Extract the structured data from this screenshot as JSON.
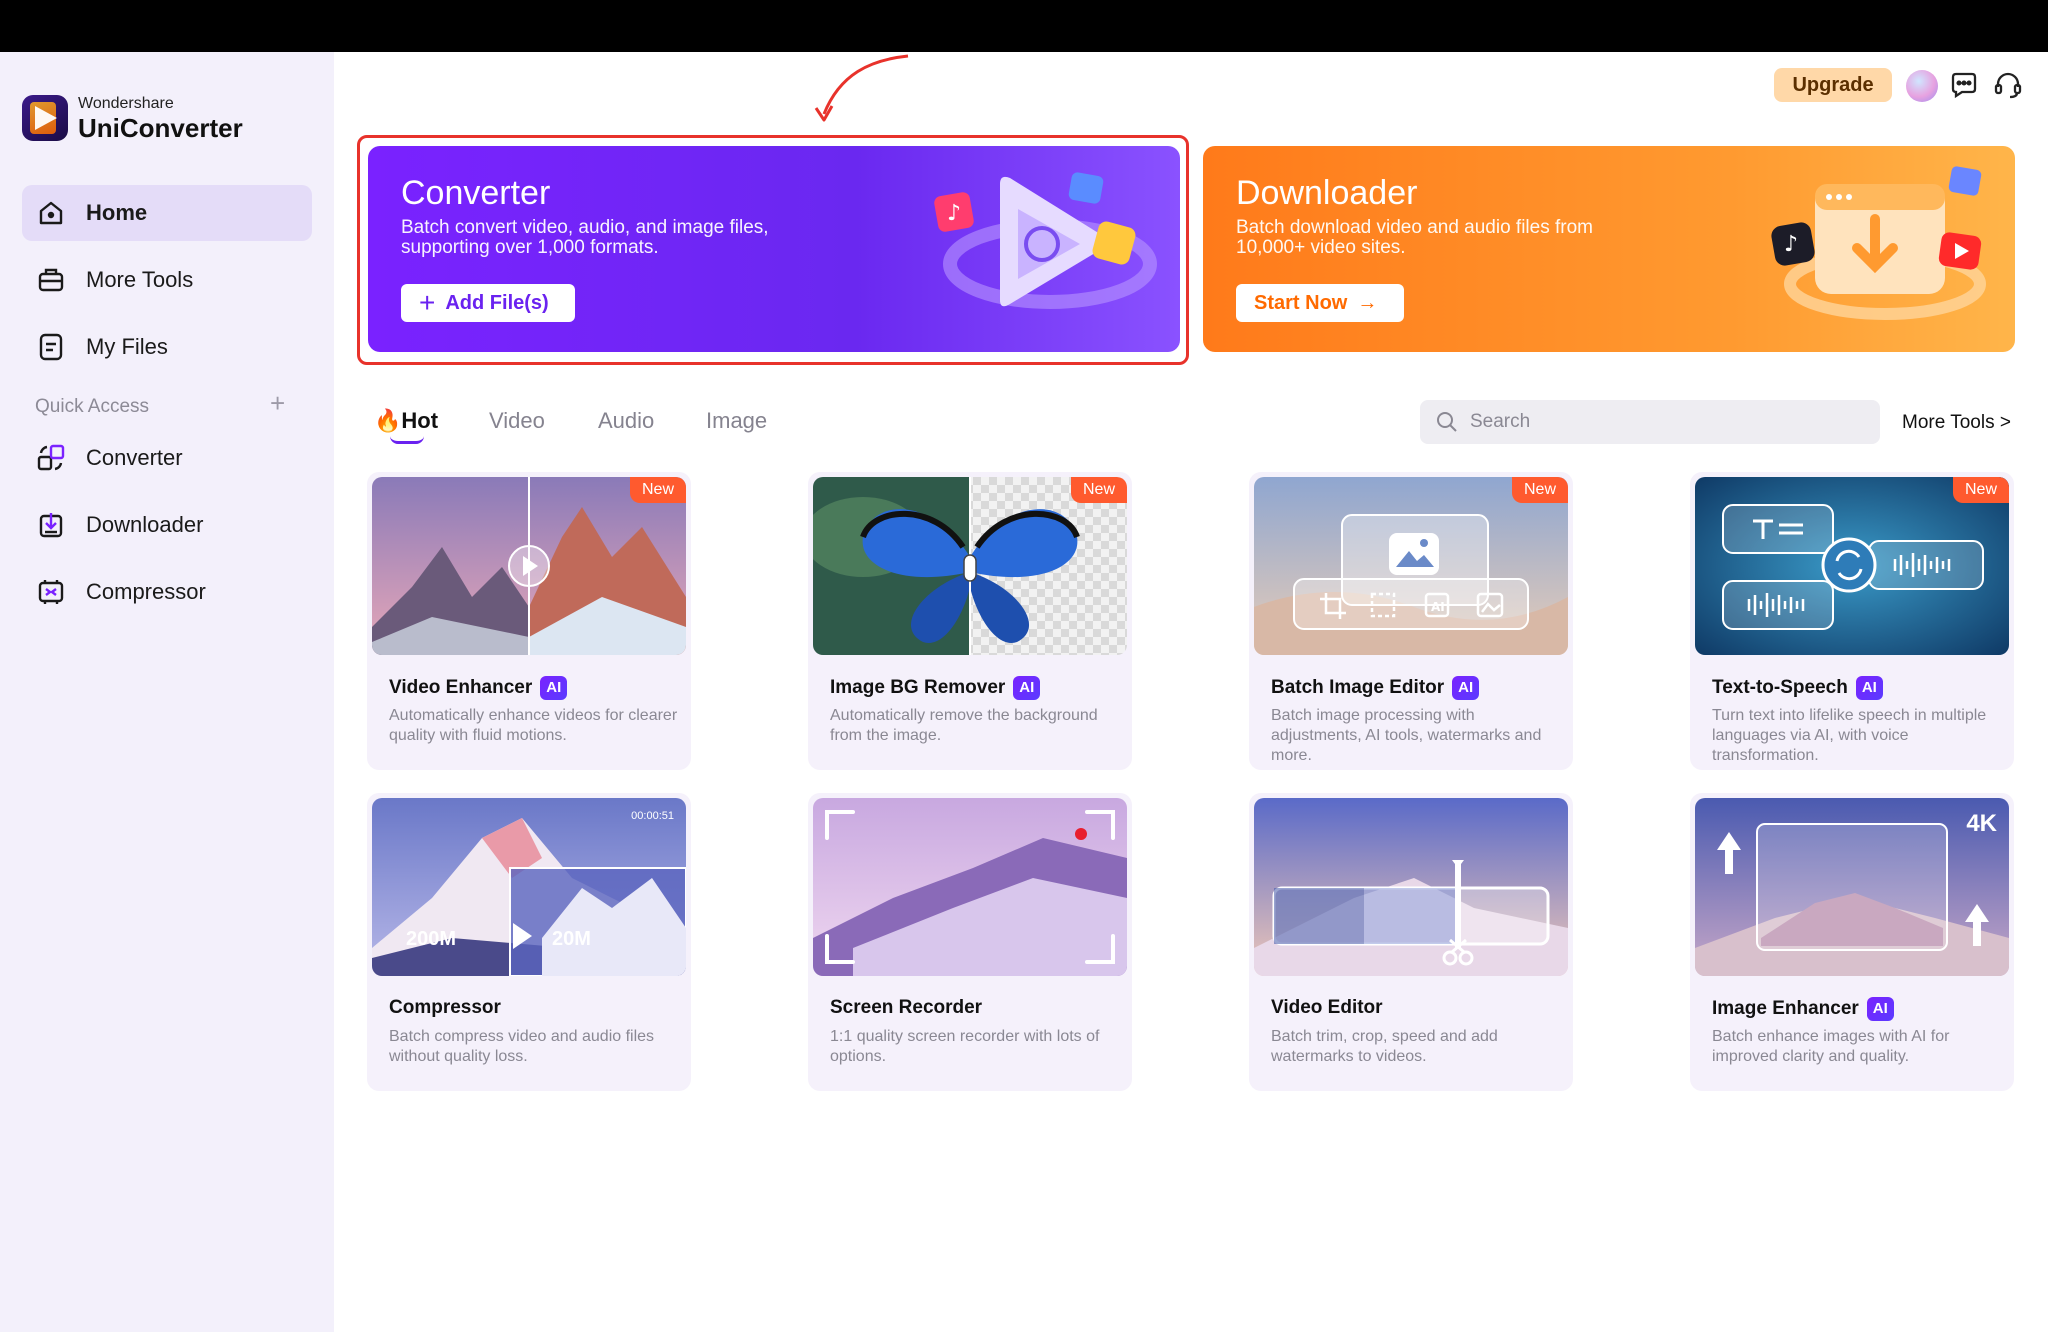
{
  "app": {
    "brand": "Wondershare",
    "name": "UniConverter"
  },
  "sidebar": {
    "items": [
      {
        "label": "Home",
        "icon": "home-icon",
        "active": true
      },
      {
        "label": "More Tools",
        "icon": "toolbox-icon"
      },
      {
        "label": "My Files",
        "icon": "file-icon"
      }
    ],
    "quick_access_title": "Quick Access",
    "quick_access_add": "+",
    "quick_access": [
      {
        "label": "Converter",
        "icon": "converter-icon"
      },
      {
        "label": "Downloader",
        "icon": "downloader-icon"
      },
      {
        "label": "Compressor",
        "icon": "compressor-icon"
      }
    ]
  },
  "header": {
    "upgrade_label": "Upgrade"
  },
  "banners": {
    "converter": {
      "title": "Converter",
      "description": "Batch convert video, audio, and image files, supporting over 1,000 formats.",
      "button": "Add File(s)",
      "button_icon": "+"
    },
    "downloader": {
      "title": "Downloader",
      "description": "Batch download video and audio files from 10,000+ video sites.",
      "button": "Start Now",
      "button_icon": "→"
    }
  },
  "tabs": [
    "Hot",
    "Video",
    "Audio",
    "Image"
  ],
  "search": {
    "placeholder": "Search"
  },
  "more_tools_link": "More Tools >",
  "new_badge": "New",
  "ai_badge": "AI",
  "cards": [
    {
      "title": "Video Enhancer",
      "ai": true,
      "new": true,
      "description": "Automatically enhance videos for clearer quality with fluid motions."
    },
    {
      "title": "Image BG Remover",
      "ai": true,
      "new": true,
      "description": "Automatically remove the background from the image."
    },
    {
      "title": "Batch Image Editor",
      "ai": true,
      "new": true,
      "description": "Batch image processing with adjustments, AI tools, watermarks and more."
    },
    {
      "title": "Text-to-Speech",
      "ai": true,
      "new": true,
      "description": "Turn text into lifelike speech in multiple languages via AI, with voice transformation."
    },
    {
      "title": "Compressor",
      "ai": false,
      "new": false,
      "description": "Batch compress video and audio files without quality loss.",
      "overlay": {
        "timestamp": "00:00:51",
        "size_from": "200M",
        "size_to": "20M"
      }
    },
    {
      "title": "Screen Recorder",
      "ai": false,
      "new": false,
      "description": "1:1 quality screen recorder with lots of options."
    },
    {
      "title": "Video Editor",
      "ai": false,
      "new": false,
      "description": "Batch trim, crop, speed and add watermarks to videos."
    },
    {
      "title": "Image Enhancer",
      "ai": true,
      "new": false,
      "description": "Batch enhance images with AI for improved clarity and quality.",
      "overlay": {
        "resolution": "4K"
      }
    }
  ],
  "colors": {
    "accent": "#6a22f0",
    "converter_banner": "#7a22ff",
    "downloader_banner": "#ff8a24",
    "highlight": "#e8322b",
    "new_badge": "#ff5a2e"
  }
}
